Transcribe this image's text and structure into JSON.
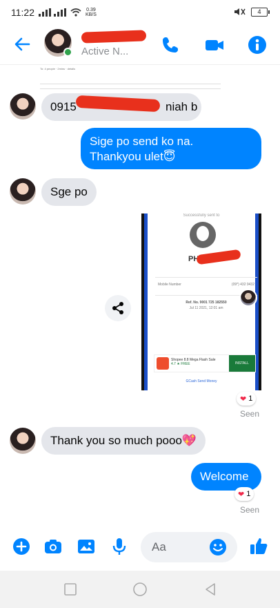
{
  "statusbar": {
    "time": "11:22",
    "speed_value": "0.39",
    "speed_unit": "KB/S",
    "battery": "4"
  },
  "header": {
    "status": "Active N..."
  },
  "messages": {
    "forwarded_snippet": "To: 4 people · 2mins · details",
    "number_message": "0915",
    "number_message_tail": "niah b",
    "send_confirm_line1": "Sige po send ko na.",
    "send_confirm_line2": "Thankyou ulet😇",
    "reply_sge": "Sge po",
    "thank_you": "Thank you so much pooo💖",
    "welcome": "Welcome",
    "reaction_count_1": "1",
    "reaction_count_2": "1",
    "seen_1": "Seen",
    "seen_2": "Seen"
  },
  "screenshot": {
    "title": "Successfully sent to",
    "recipient_initials": "PH",
    "mobile_label": "Mobile Number",
    "mobile_value": "(09*) 432 9432",
    "ref_label": "Ref. No. 9001 725 182550",
    "date": "Jul 11 2021, 12:01 am",
    "ad_title": "Shopee 8.8 Mega Flash Sale",
    "ad_sub": "4.7 ★ FREE",
    "ad_button": "INSTALL",
    "footer": "GCash Send Money"
  },
  "composer": {
    "placeholder": "Aa"
  },
  "colors": {
    "messenger_blue": "#0084ff",
    "incoming_bubble": "#e4e6eb",
    "online_green": "#31a24c",
    "redaction_red": "#e8301c"
  },
  "icons": [
    "back-arrow-icon",
    "phone-icon",
    "video-camera-icon",
    "info-icon",
    "share-icon",
    "plus-icon",
    "camera-icon",
    "image-icon",
    "microphone-icon",
    "emoji-icon",
    "thumbs-up-icon"
  ]
}
